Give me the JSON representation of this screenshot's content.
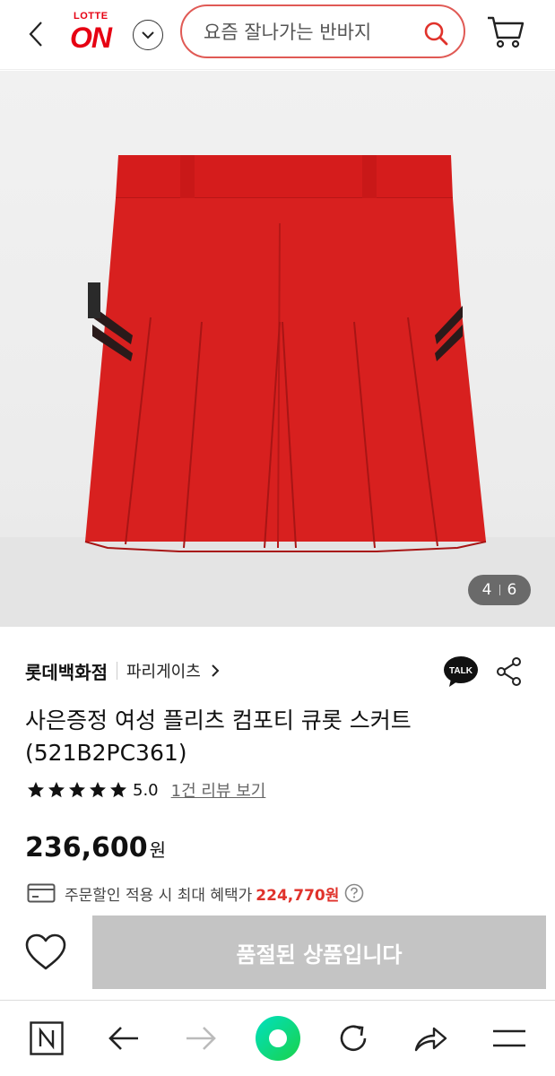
{
  "header": {
    "logo_top": "LOTTE",
    "logo_main": "ON",
    "search_placeholder": "요즘 잘나가는 반바지",
    "brand_color": "#e60012",
    "search_border_color": "#e05a55",
    "icons": [
      "chevron-left-icon",
      "chevron-down-icon",
      "search-icon",
      "cart-icon"
    ]
  },
  "gallery": {
    "current": "4",
    "total": "6"
  },
  "product": {
    "brand": "롯데백화점",
    "sub_brand": "파리게이츠",
    "title": "사은증정 여성 플리츠 컴포티 큐롯 스커트 (521B2PC361)",
    "rating": "5.0",
    "stars": 5,
    "review_link": "1건 리뷰 보기",
    "price": "236,600",
    "currency": "원",
    "benefit_text": "주문할인 적용 시 최대 혜택가",
    "benefit_amount": "224,770원",
    "benefit_color": "#e0322b",
    "talk_label": "TALK"
  },
  "purchase": {
    "soldout_label": "품절된 상품입니다"
  },
  "bottom_nav": {
    "icons": [
      "naver-n-icon",
      "arrow-left-icon",
      "arrow-right-icon",
      "green-dot-icon",
      "refresh-icon",
      "share-arrow-icon",
      "menu-icon"
    ],
    "accent_color": "#03d67a"
  }
}
